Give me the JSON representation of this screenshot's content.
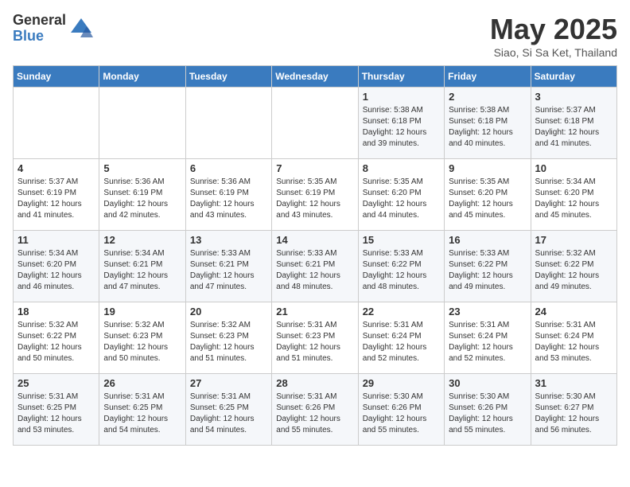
{
  "logo": {
    "general": "General",
    "blue": "Blue"
  },
  "title": "May 2025",
  "subtitle": "Siao, Si Sa Ket, Thailand",
  "days_of_week": [
    "Sunday",
    "Monday",
    "Tuesday",
    "Wednesday",
    "Thursday",
    "Friday",
    "Saturday"
  ],
  "weeks": [
    [
      {
        "day": "",
        "info": ""
      },
      {
        "day": "",
        "info": ""
      },
      {
        "day": "",
        "info": ""
      },
      {
        "day": "",
        "info": ""
      },
      {
        "day": "1",
        "info": "Sunrise: 5:38 AM\nSunset: 6:18 PM\nDaylight: 12 hours\nand 39 minutes."
      },
      {
        "day": "2",
        "info": "Sunrise: 5:38 AM\nSunset: 6:18 PM\nDaylight: 12 hours\nand 40 minutes."
      },
      {
        "day": "3",
        "info": "Sunrise: 5:37 AM\nSunset: 6:18 PM\nDaylight: 12 hours\nand 41 minutes."
      }
    ],
    [
      {
        "day": "4",
        "info": "Sunrise: 5:37 AM\nSunset: 6:19 PM\nDaylight: 12 hours\nand 41 minutes."
      },
      {
        "day": "5",
        "info": "Sunrise: 5:36 AM\nSunset: 6:19 PM\nDaylight: 12 hours\nand 42 minutes."
      },
      {
        "day": "6",
        "info": "Sunrise: 5:36 AM\nSunset: 6:19 PM\nDaylight: 12 hours\nand 43 minutes."
      },
      {
        "day": "7",
        "info": "Sunrise: 5:35 AM\nSunset: 6:19 PM\nDaylight: 12 hours\nand 43 minutes."
      },
      {
        "day": "8",
        "info": "Sunrise: 5:35 AM\nSunset: 6:20 PM\nDaylight: 12 hours\nand 44 minutes."
      },
      {
        "day": "9",
        "info": "Sunrise: 5:35 AM\nSunset: 6:20 PM\nDaylight: 12 hours\nand 45 minutes."
      },
      {
        "day": "10",
        "info": "Sunrise: 5:34 AM\nSunset: 6:20 PM\nDaylight: 12 hours\nand 45 minutes."
      }
    ],
    [
      {
        "day": "11",
        "info": "Sunrise: 5:34 AM\nSunset: 6:20 PM\nDaylight: 12 hours\nand 46 minutes."
      },
      {
        "day": "12",
        "info": "Sunrise: 5:34 AM\nSunset: 6:21 PM\nDaylight: 12 hours\nand 47 minutes."
      },
      {
        "day": "13",
        "info": "Sunrise: 5:33 AM\nSunset: 6:21 PM\nDaylight: 12 hours\nand 47 minutes."
      },
      {
        "day": "14",
        "info": "Sunrise: 5:33 AM\nSunset: 6:21 PM\nDaylight: 12 hours\nand 48 minutes."
      },
      {
        "day": "15",
        "info": "Sunrise: 5:33 AM\nSunset: 6:22 PM\nDaylight: 12 hours\nand 48 minutes."
      },
      {
        "day": "16",
        "info": "Sunrise: 5:33 AM\nSunset: 6:22 PM\nDaylight: 12 hours\nand 49 minutes."
      },
      {
        "day": "17",
        "info": "Sunrise: 5:32 AM\nSunset: 6:22 PM\nDaylight: 12 hours\nand 49 minutes."
      }
    ],
    [
      {
        "day": "18",
        "info": "Sunrise: 5:32 AM\nSunset: 6:22 PM\nDaylight: 12 hours\nand 50 minutes."
      },
      {
        "day": "19",
        "info": "Sunrise: 5:32 AM\nSunset: 6:23 PM\nDaylight: 12 hours\nand 50 minutes."
      },
      {
        "day": "20",
        "info": "Sunrise: 5:32 AM\nSunset: 6:23 PM\nDaylight: 12 hours\nand 51 minutes."
      },
      {
        "day": "21",
        "info": "Sunrise: 5:31 AM\nSunset: 6:23 PM\nDaylight: 12 hours\nand 51 minutes."
      },
      {
        "day": "22",
        "info": "Sunrise: 5:31 AM\nSunset: 6:24 PM\nDaylight: 12 hours\nand 52 minutes."
      },
      {
        "day": "23",
        "info": "Sunrise: 5:31 AM\nSunset: 6:24 PM\nDaylight: 12 hours\nand 52 minutes."
      },
      {
        "day": "24",
        "info": "Sunrise: 5:31 AM\nSunset: 6:24 PM\nDaylight: 12 hours\nand 53 minutes."
      }
    ],
    [
      {
        "day": "25",
        "info": "Sunrise: 5:31 AM\nSunset: 6:25 PM\nDaylight: 12 hours\nand 53 minutes."
      },
      {
        "day": "26",
        "info": "Sunrise: 5:31 AM\nSunset: 6:25 PM\nDaylight: 12 hours\nand 54 minutes."
      },
      {
        "day": "27",
        "info": "Sunrise: 5:31 AM\nSunset: 6:25 PM\nDaylight: 12 hours\nand 54 minutes."
      },
      {
        "day": "28",
        "info": "Sunrise: 5:31 AM\nSunset: 6:26 PM\nDaylight: 12 hours\nand 55 minutes."
      },
      {
        "day": "29",
        "info": "Sunrise: 5:30 AM\nSunset: 6:26 PM\nDaylight: 12 hours\nand 55 minutes."
      },
      {
        "day": "30",
        "info": "Sunrise: 5:30 AM\nSunset: 6:26 PM\nDaylight: 12 hours\nand 55 minutes."
      },
      {
        "day": "31",
        "info": "Sunrise: 5:30 AM\nSunset: 6:27 PM\nDaylight: 12 hours\nand 56 minutes."
      }
    ]
  ]
}
